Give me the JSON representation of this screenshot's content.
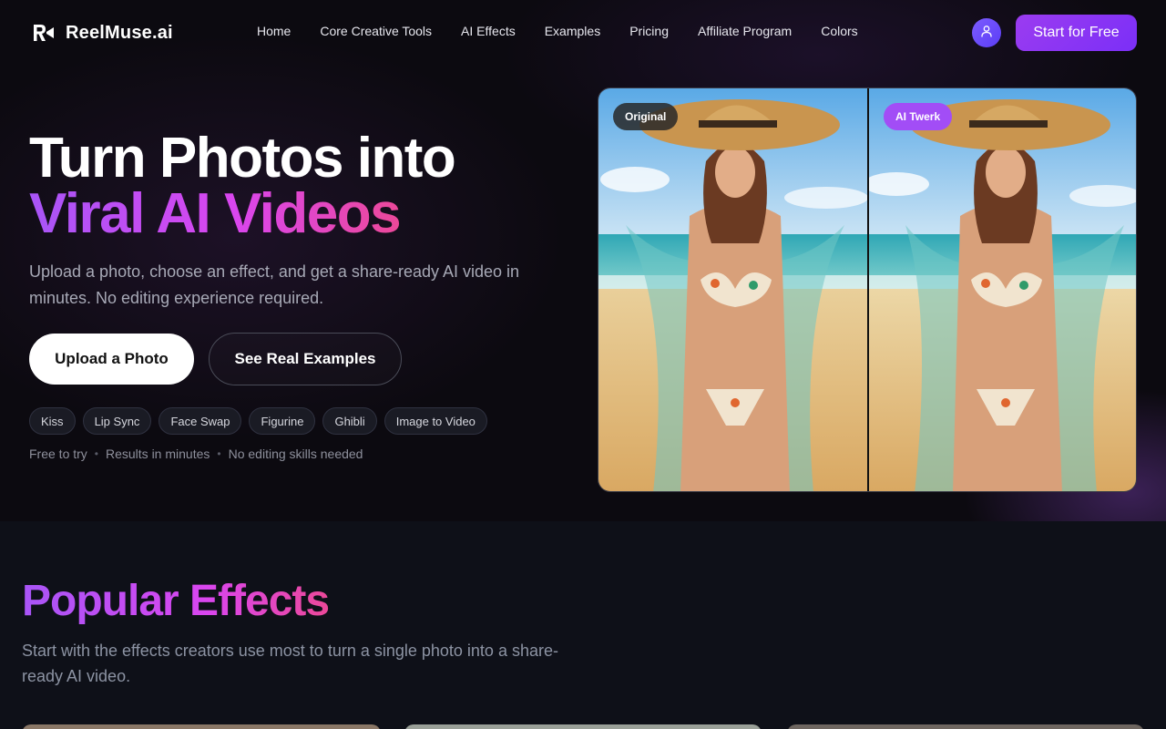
{
  "brand": {
    "name": "ReelMuse.ai"
  },
  "nav": {
    "links": [
      "Home",
      "Core Creative Tools",
      "AI Effects",
      "Examples",
      "Pricing",
      "Affiliate Program",
      "Colors"
    ],
    "account_icon": "user-icon",
    "cta_label": "Start for Free"
  },
  "hero": {
    "title_line1": "Turn Photos into",
    "title_line2": "Viral AI Videos",
    "subtitle": "Upload a photo, choose an effect, and get a share-ready AI video in minutes. No editing experience required.",
    "primary_button": "Upload a Photo",
    "secondary_button": "See Real Examples",
    "chips": [
      "Kiss",
      "Lip Sync",
      "Face Swap",
      "Figurine",
      "Ghibli",
      "Image to Video"
    ],
    "perks": [
      "Free to try",
      "Results in minutes",
      "No editing skills needed"
    ]
  },
  "compare": {
    "left_badge": "Original",
    "right_badge": "AI Twerk"
  },
  "popular": {
    "title": "Popular Effects",
    "subtitle": "Start with the effects creators use most to turn a single photo into a share-ready AI video."
  },
  "colors": {
    "accent": "#9b3cf0",
    "gradient_start": "#a855f7",
    "gradient_end": "#ec4899",
    "background": "#0e1018"
  }
}
